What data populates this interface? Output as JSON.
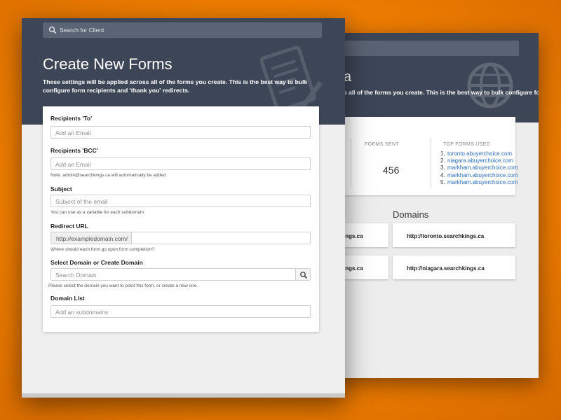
{
  "front": {
    "search": {
      "placeholder": "Search for Client",
      "icon": "search-icon"
    },
    "title": "Create New Forms",
    "description": "These settings will be applied across all of the forms you create. This is the best way to bulk configure form recipients and 'thank you' redirects.",
    "form": {
      "recipients_to": {
        "label": "Recipients 'To'",
        "placeholder": "Add an Email"
      },
      "recipients_bcc": {
        "label": "Recipients 'BCC'",
        "placeholder": "Add an Email",
        "note": "Note: admin@searchkings.ca will automatically be added"
      },
      "subject": {
        "label": "Subject",
        "placeholder": "Subject of the email",
        "note": "You can use as a variable for each subdomain"
      },
      "redirect": {
        "label": "Redirect URL",
        "addon": "http://exampledomain.com/",
        "note": "Where should each form go upon form completion?"
      },
      "domain_select": {
        "label": "Select Domain or Create Domain",
        "placeholder": "Search Domain",
        "note": "Please select the domain you want to point this form, or create a new one.",
        "button_icon": "search-icon"
      },
      "domain_list": {
        "label": "Domain List",
        "placeholder": "Add an subdomains"
      }
    }
  },
  "back": {
    "title_fragment": "a",
    "description_fragment": "s all of the forms you create. This is the best way to bulk configure form",
    "stats": {
      "forms_sent_label": "FORMS SENT",
      "forms_sent_value": "456",
      "top_forms_label": "TOP FORMS USED",
      "top_forms": [
        {
          "num": "1.",
          "url": "toronto.abuyerchoice.com"
        },
        {
          "num": "2.",
          "url": "niagara.abuyerchoice.com"
        },
        {
          "num": "3.",
          "url": "markham.abuyerchoice.com"
        },
        {
          "num": "4.",
          "url": "markham.abuyerchoice.com"
        },
        {
          "num": "5.",
          "url": "markham.abuyerchoice.com"
        }
      ]
    },
    "domains_heading": "Domains",
    "domain_cards": [
      {
        "text": "ings.ca"
      },
      {
        "text": "http://toronto.searchkings.ca"
      },
      {
        "text": "ings.ca"
      },
      {
        "text": "http://niagara.searchkings.ca"
      }
    ]
  },
  "colors": {
    "background": "#ef7d00",
    "header": "#3d4657",
    "link": "#2a6bb8"
  }
}
